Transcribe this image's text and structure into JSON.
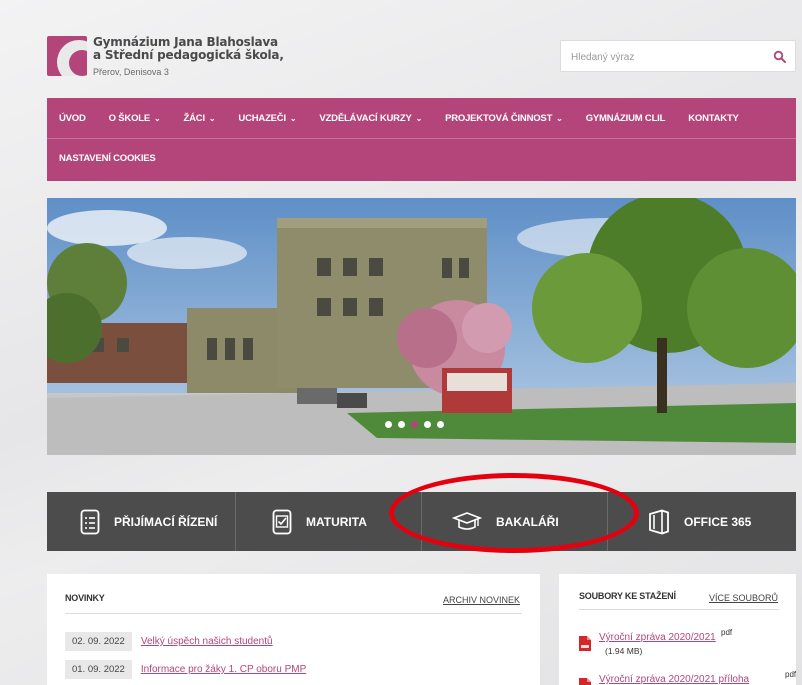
{
  "header": {
    "school_name_line1": "Gymnázium Jana Blahoslava",
    "school_name_line2": "a Střední pedagogická škola,",
    "address": "Přerov, Denisova 3",
    "search_placeholder": "Hledaný výraz"
  },
  "nav": {
    "row1": [
      {
        "label": "Úvod",
        "dropdown": false
      },
      {
        "label": "O škole",
        "dropdown": true
      },
      {
        "label": "Žáci",
        "dropdown": true
      },
      {
        "label": "Uchazeči",
        "dropdown": true
      },
      {
        "label": "Vzdělávací kurzy",
        "dropdown": true
      },
      {
        "label": "Projektová činnost",
        "dropdown": true
      },
      {
        "label": "Gymnázium CLIL",
        "dropdown": false
      },
      {
        "label": "Kontakty",
        "dropdown": false
      }
    ],
    "row2": [
      {
        "label": "Nastavení cookies",
        "dropdown": false
      }
    ]
  },
  "slider": {
    "dots": 5,
    "active_index": 2
  },
  "quicklinks": [
    {
      "label": "Přijímací řízení",
      "icon": "document-list-icon"
    },
    {
      "label": "Maturita",
      "icon": "checkbox-icon"
    },
    {
      "label": "Bakaláři",
      "icon": "graduation-cap-icon"
    },
    {
      "label": "Office 365",
      "icon": "office-icon"
    }
  ],
  "news": {
    "title": "Novinky",
    "archive_link": "Archiv novinek",
    "items": [
      {
        "date": "02. 09. 2022",
        "title": "Velký úspěch našich studentů"
      },
      {
        "date": "01. 09. 2022",
        "title": "Informace pro žáky 1. CP oboru PMP"
      }
    ]
  },
  "files": {
    "title": "Soubory ke stažení",
    "more_link": "Více souborů",
    "items": [
      {
        "name": "Výroční zpráva 2020/2021",
        "ext": "pdf",
        "size": "(1.94 MB)"
      },
      {
        "name": "Výroční zpráva 2020/2021 příloha",
        "ext": "pdf",
        "size": ""
      }
    ]
  },
  "colors": {
    "brand": "#b3457a",
    "quickbar": "#4c4c4c",
    "highlight": "#e4000f"
  }
}
